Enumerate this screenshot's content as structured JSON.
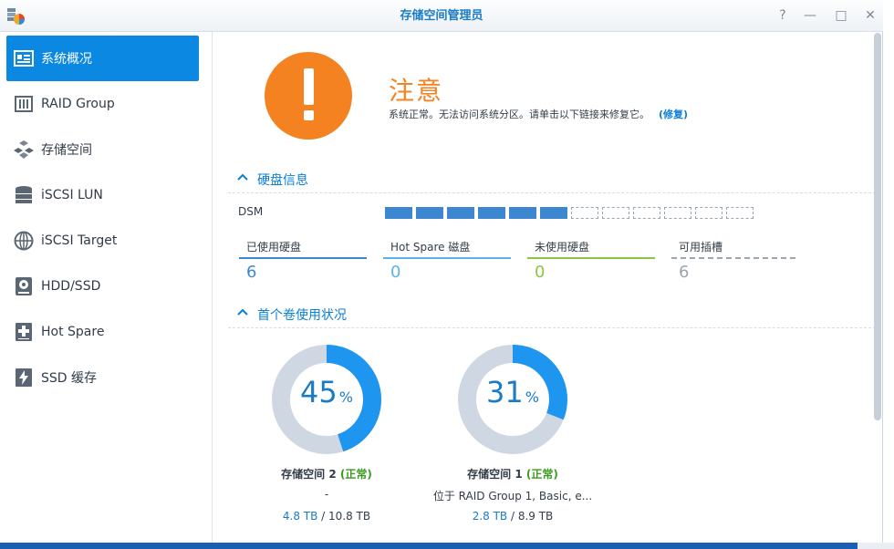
{
  "window": {
    "title": "存储空间管理员",
    "controls": [
      "?",
      "—",
      "□",
      "✕"
    ]
  },
  "sidebar": {
    "items": [
      {
        "label": "系统概况",
        "icon": "overview-icon",
        "active": true
      },
      {
        "label": "RAID Group",
        "icon": "raid-group-icon",
        "active": false
      },
      {
        "label": "存储空间",
        "icon": "storage-volume-icon",
        "active": false
      },
      {
        "label": "iSCSI LUN",
        "icon": "iscsi-lun-icon",
        "active": false
      },
      {
        "label": "iSCSI Target",
        "icon": "iscsi-target-icon",
        "active": false
      },
      {
        "label": "HDD/SSD",
        "icon": "hdd-icon",
        "active": false
      },
      {
        "label": "Hot Spare",
        "icon": "hot-spare-icon",
        "active": false
      },
      {
        "label": "SSD 缓存",
        "icon": "ssd-cache-icon",
        "active": false
      }
    ]
  },
  "status": {
    "title": "注意",
    "message": "系统正常。无法访问系统分区。请单击以下链接来修复它。",
    "repair_link": "(修复)",
    "icon": "warning-icon",
    "color": "#f58220"
  },
  "disk_info": {
    "heading": "硬盘信息",
    "dsm_label": "DSM",
    "slots_used": 6,
    "slots_total": 12,
    "stats": [
      {
        "name": "已使用硬盘",
        "value": "6",
        "color": "#3d87d0"
      },
      {
        "name": "Hot Spare 磁盘",
        "value": "0",
        "color": "#5cb2ea"
      },
      {
        "name": "未使用硬盘",
        "value": "0",
        "color": "#8cc63f"
      },
      {
        "name": "可用插槽",
        "value": "6",
        "color": "#9aa5b0"
      }
    ]
  },
  "volumes": {
    "heading": "首个卷使用状况",
    "items": [
      {
        "percent": 45,
        "percent_text": "45",
        "unit": "%",
        "name": "存储空间 2",
        "status": "(正常)",
        "subtitle": "-",
        "used": "4.8 TB",
        "total": " / 10.8 TB"
      },
      {
        "percent": 31,
        "percent_text": "31",
        "unit": "%",
        "name": "存储空间 1",
        "status": "(正常)",
        "subtitle": "位于 RAID Group 1, Basic, e...",
        "used": "2.8 TB",
        "total": " / 8.9 TB"
      }
    ]
  }
}
